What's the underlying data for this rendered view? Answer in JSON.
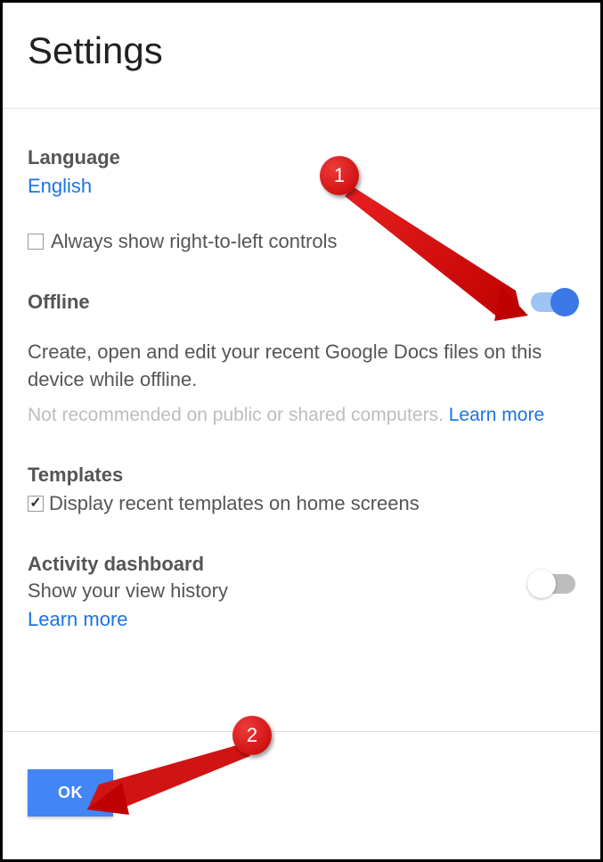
{
  "header": {
    "title": "Settings"
  },
  "language": {
    "title": "Language",
    "value": "English",
    "rtl_checkbox_label": "Always show right-to-left controls",
    "rtl_checked": false
  },
  "offline": {
    "title": "Offline",
    "toggle_on": true,
    "description": "Create, open and edit your recent Google Docs files on this device while offline.",
    "hint": "Not recommended on public or shared computers.",
    "learn_more": "Learn more"
  },
  "templates": {
    "title": "Templates",
    "checkbox_label": "Display recent templates on home screens",
    "checked": true
  },
  "activity": {
    "title": "Activity dashboard",
    "description": "Show your view history",
    "learn_more": "Learn more",
    "toggle_on": false
  },
  "footer": {
    "ok": "OK"
  },
  "annotations": {
    "callout1": "1",
    "callout2": "2"
  }
}
